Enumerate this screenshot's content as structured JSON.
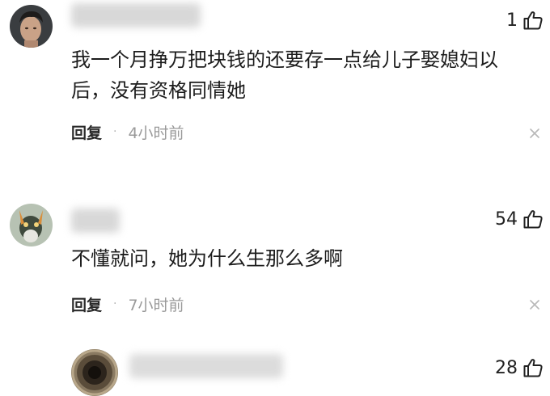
{
  "comments": [
    {
      "likes": "1",
      "text": "我一个月挣万把块钱的还要存一点给儿子娶媳妇以后，没有资格同情她",
      "reply_label": "回复",
      "separator": "·",
      "time": "4小时前"
    },
    {
      "likes": "54",
      "text": "不懂就问，她为什么生那么多啊",
      "reply_label": "回复",
      "separator": "·",
      "time": "7小时前"
    },
    {
      "likes": "28"
    }
  ],
  "colors": {
    "text": "#1c1c1c",
    "muted": "#9a9a9a",
    "username_blur": "#d8d8d8"
  }
}
